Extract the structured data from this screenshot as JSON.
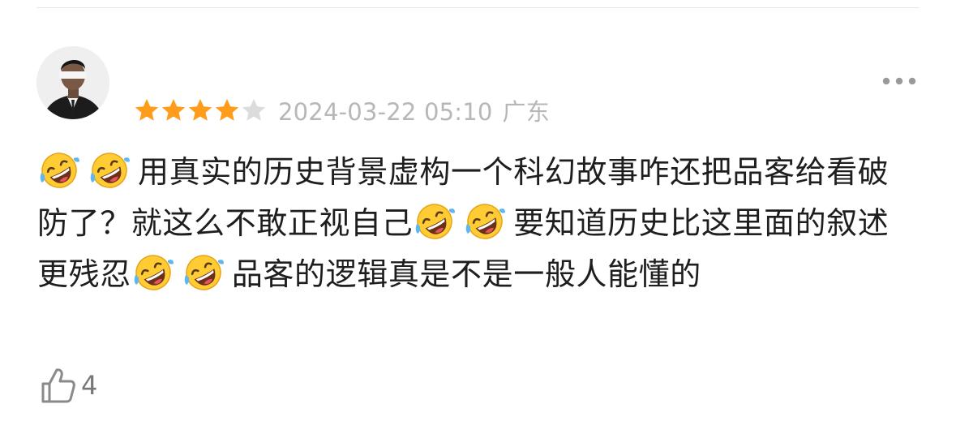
{
  "review": {
    "rating": 4,
    "rating_max": 5,
    "timestamp": "2024-03-22 05:10",
    "location": "广东",
    "text_segments": [
      {
        "type": "emoji",
        "name": "rofl-emoji"
      },
      {
        "type": "emoji",
        "name": "rofl-emoji"
      },
      {
        "type": "text",
        "value": "用真实的历史背景虚构一个科幻故事咋还把品客给看破防了？就这么不敢正视自己"
      },
      {
        "type": "emoji",
        "name": "rofl-emoji"
      },
      {
        "type": "emoji",
        "name": "rofl-emoji"
      },
      {
        "type": "text",
        "value": "要知道历史比这里面的叙述更残忍"
      },
      {
        "type": "emoji",
        "name": "rofl-emoji"
      },
      {
        "type": "emoji",
        "name": "rofl-emoji"
      },
      {
        "type": "text",
        "value": "品客的逻辑真是不是一般人能懂的"
      }
    ],
    "like_count": "4"
  },
  "colors": {
    "star_filled": "#ff9c1a",
    "star_empty": "#dcdcdc",
    "meta_text": "#b7b7b7",
    "body_text": "#1e1e1e",
    "like_text": "#777777",
    "divider": "#e6e6e6"
  },
  "icons": {
    "more": "more-dots-icon",
    "like": "thumbs-up-icon",
    "emoji": "rofl-emoji"
  }
}
